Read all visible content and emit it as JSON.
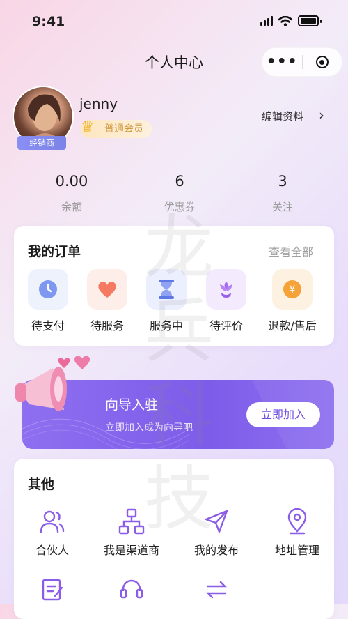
{
  "status_bar": {
    "time": "9:41"
  },
  "nav": {
    "title": "个人中心",
    "more_label": "•••"
  },
  "profile": {
    "username": "jenny",
    "role_badge": "经销商",
    "member_level": "普通会员",
    "edit_label": "编辑资料"
  },
  "stats": [
    {
      "value": "0.00",
      "label": "余额"
    },
    {
      "value": "6",
      "label": "优惠券"
    },
    {
      "value": "3",
      "label": "关注"
    }
  ],
  "orders": {
    "title": "我的订单",
    "see_all": "查看全部",
    "items": [
      {
        "label": "待支付",
        "icon": "clock-icon",
        "color": "#6f8ff3"
      },
      {
        "label": "待服务",
        "icon": "heart-icon",
        "color": "#f2765b"
      },
      {
        "label": "服务中",
        "icon": "hourglass-icon",
        "color": "#5f78e8"
      },
      {
        "label": "待评价",
        "icon": "flower-icon",
        "color": "#a66cf0"
      },
      {
        "label": "退款/售后",
        "icon": "yen-coin-icon",
        "color": "#f5a338"
      }
    ]
  },
  "banner": {
    "title": "向导入驻",
    "subtitle": "立即加入成为向导吧",
    "button": "立即加入",
    "color": "#7d5ce9"
  },
  "others": {
    "title": "其他",
    "items": [
      {
        "label": "合伙人",
        "icon": "users-icon"
      },
      {
        "label": "我是渠道商",
        "icon": "network-icon"
      },
      {
        "label": "我的发布",
        "icon": "send-icon"
      },
      {
        "label": "地址管理",
        "icon": "location-icon"
      },
      {
        "label": "",
        "icon": "edit-note-icon"
      },
      {
        "label": "",
        "icon": "headset-icon"
      },
      {
        "label": "",
        "icon": "swap-icon"
      }
    ],
    "icon_color": "#8a5ce8"
  },
  "watermark": "龙兵科技"
}
